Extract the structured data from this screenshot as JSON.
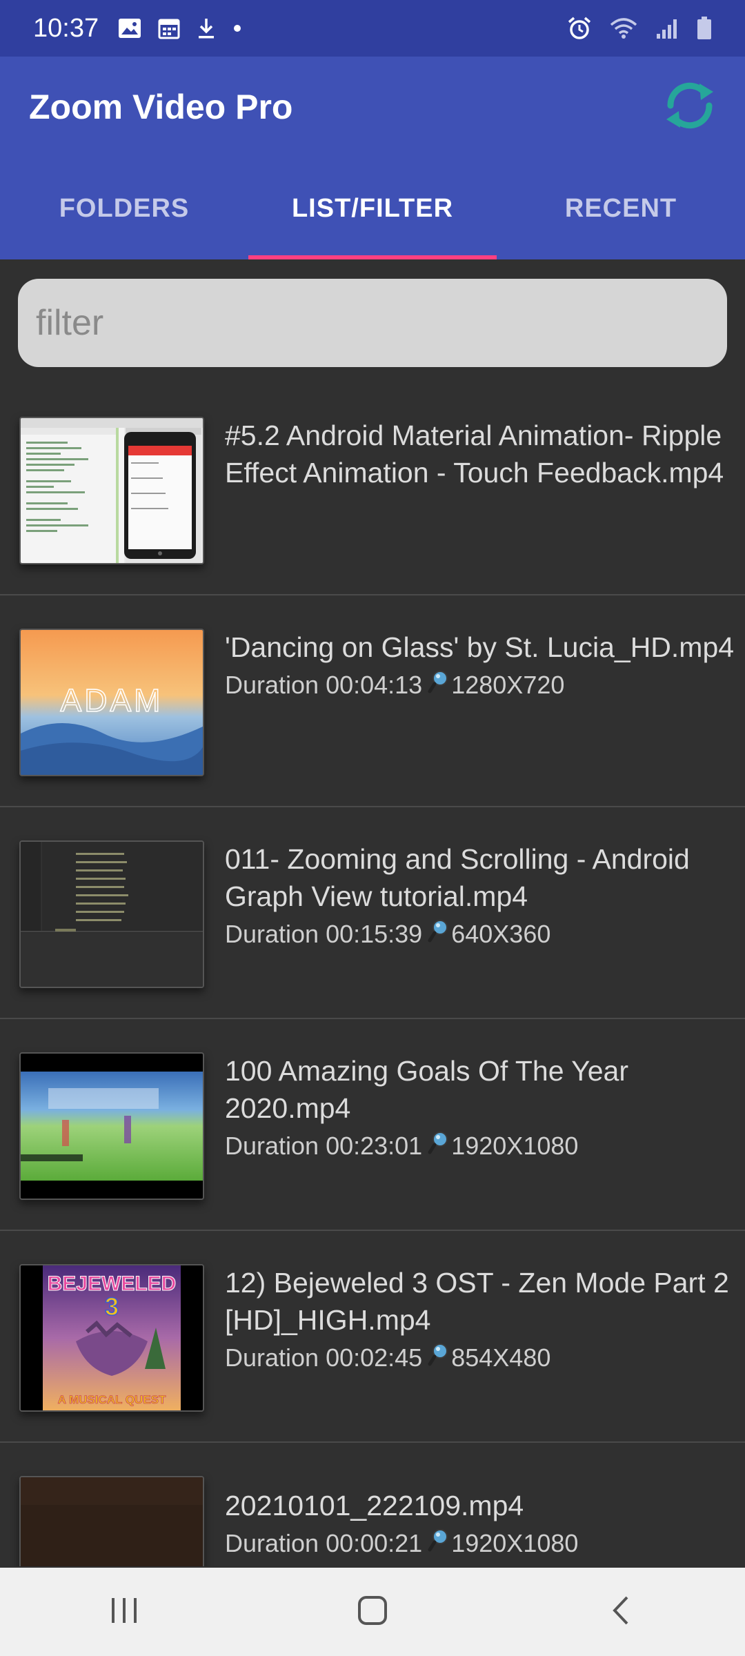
{
  "status": {
    "time": "10:37",
    "left_icons": [
      "image-icon",
      "calendar-icon",
      "download-icon",
      "dot-icon"
    ],
    "right_icons": [
      "alarm-icon",
      "wifi-icon",
      "signal-icon",
      "battery-icon"
    ]
  },
  "appbar": {
    "title": "Zoom Video Pro",
    "sync_icon": "sync-icon",
    "accent": "#26a69a"
  },
  "tabs": [
    {
      "label": "FOLDERS",
      "active": false
    },
    {
      "label": "LIST/FILTER",
      "active": true
    },
    {
      "label": "RECENT",
      "active": false
    }
  ],
  "filter": {
    "placeholder": "filter",
    "value": ""
  },
  "videos": [
    {
      "title": "#5.2 Android Material Animation- Ripple Effect Animation - Touch Feedback.mp4",
      "duration_label": "",
      "resolution": ""
    },
    {
      "title": "'Dancing on Glass' by St. Lucia_HD.mp4",
      "duration_label": "Duration 00:04:13",
      "resolution": "1280X720",
      "thumb_text": "ADAM"
    },
    {
      "title": "011- Zooming and Scrolling - Android Graph View tutorial.mp4",
      "duration_label": "Duration 00:15:39",
      "resolution": "640X360"
    },
    {
      "title": "100 Amazing Goals Of The Year 2020.mp4",
      "duration_label": "Duration 00:23:01",
      "resolution": "1920X1080"
    },
    {
      "title": "12) Bejeweled 3 OST - Zen Mode Part 2 [HD]_HIGH.mp4",
      "duration_label": "Duration 00:02:45",
      "resolution": "854X480",
      "thumb_text": "BEJEWELED",
      "thumb_sub": "A MUSICAL QUEST"
    },
    {
      "title": "20210101_222109.mp4",
      "duration_label": "Duration 00:00:21",
      "resolution": "1920X1080"
    }
  ],
  "navbar": [
    "recent-apps-icon",
    "home-icon",
    "back-icon"
  ]
}
